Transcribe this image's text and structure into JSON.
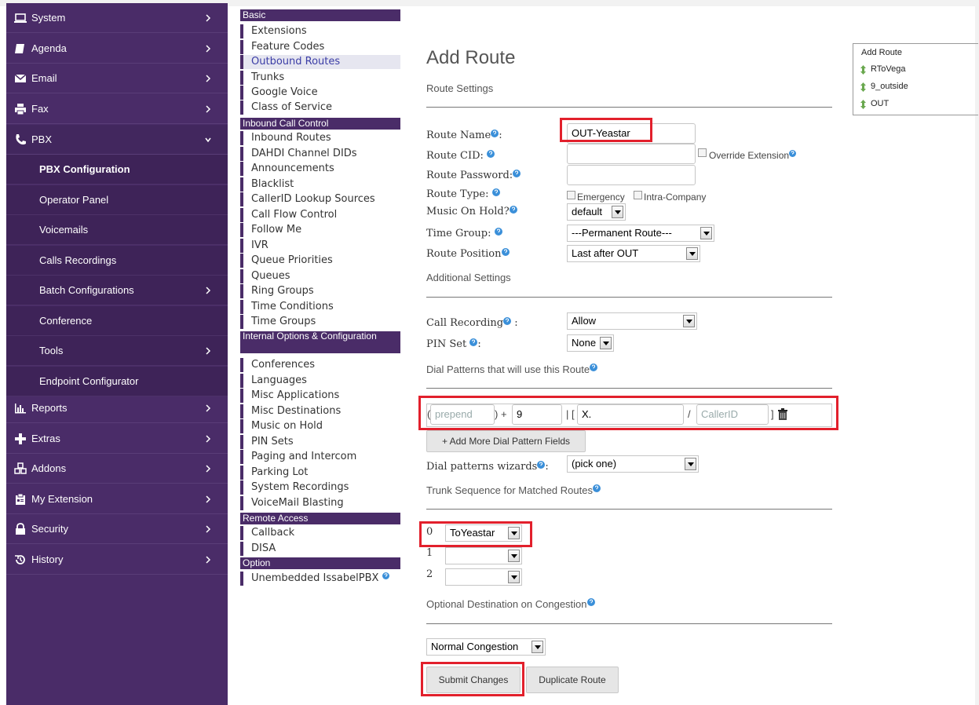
{
  "sidebar": {
    "top_items": [
      {
        "label": "System",
        "icon": "laptop-icon"
      },
      {
        "label": "Agenda",
        "icon": "book-icon"
      },
      {
        "label": "Email",
        "icon": "envelope-icon"
      },
      {
        "label": "Fax",
        "icon": "printer-icon"
      },
      {
        "label": "PBX",
        "icon": "phone-icon"
      }
    ],
    "pbx_sub": [
      {
        "label": "PBX Configuration"
      },
      {
        "label": "Operator Panel"
      },
      {
        "label": "Voicemails"
      },
      {
        "label": "Calls Recordings"
      },
      {
        "label": "Batch Configurations"
      },
      {
        "label": "Conference"
      },
      {
        "label": "Tools"
      },
      {
        "label": "Endpoint Configurator"
      }
    ],
    "bottom_items": [
      {
        "label": "Reports",
        "icon": "bar-chart-icon"
      },
      {
        "label": "Extras",
        "icon": "plus-icon"
      },
      {
        "label": "Addons",
        "icon": "cubes-icon"
      },
      {
        "label": "My Extension",
        "icon": "id-card-icon"
      },
      {
        "label": "Security",
        "icon": "lock-icon"
      },
      {
        "label": "History",
        "icon": "history-icon"
      }
    ]
  },
  "module_menu": {
    "headers": [
      "Basic",
      "Inbound Call Control",
      "Internal Options & Configuration",
      "Remote Access",
      "Option"
    ],
    "basic": [
      "Extensions",
      "Feature Codes",
      "Outbound Routes",
      "Trunks",
      "Google Voice",
      "Class of Service"
    ],
    "inbound": [
      "Inbound Routes",
      "DAHDI Channel DIDs",
      "Announcements",
      "Blacklist",
      "CallerID Lookup Sources",
      "Call Flow Control",
      "Follow Me",
      "IVR",
      "Queue Priorities",
      "Queues",
      "Ring Groups",
      "Time Conditions",
      "Time Groups"
    ],
    "internal": [
      "Conferences",
      "Languages",
      "Misc Applications",
      "Misc Destinations",
      "Music on Hold",
      "PIN Sets",
      "Paging and Intercom",
      "Parking Lot",
      "System Recordings",
      "VoiceMail Blasting"
    ],
    "remote": [
      "Callback",
      "DISA"
    ],
    "option": [
      "Unembedded IssabelPBX"
    ]
  },
  "form": {
    "title": "Add Route",
    "route_settings": "Route Settings",
    "route_name_label": "Route Name",
    "route_name_value": "OUT-Yeastar",
    "route_cid_label": "Route CID:",
    "override_ext_label": "Override Extension",
    "route_password_label": "Route Password:",
    "route_type_label": "Route Type:",
    "emergency_label": "Emergency",
    "intra_company_label": "Intra-Company",
    "music_on_hold_label": "Music On Hold?",
    "music_on_hold_value": "default",
    "time_group_label": "Time Group:",
    "time_group_value": "---Permanent Route---",
    "route_position_label": "Route Position",
    "route_position_value": "Last after OUT",
    "additional_settings": "Additional Settings",
    "call_recording_label": "Call Recording",
    "call_recording_value": "Allow",
    "pin_set_label": "PIN Set",
    "pin_set_value": "None",
    "dial_patterns_heading": "Dial Patterns that will use this Route",
    "prepend_placeholder": "prepend",
    "prefix_value": "9",
    "match_pattern_value": "X.",
    "callerid_placeholder": "CallerID",
    "open_paren": "(",
    "close_paren_plus": ") +",
    "pipe_bracket": "| [",
    "slash": "/",
    "close_bracket": "]",
    "add_more_label": "+ Add More Dial Pattern Fields",
    "dial_wizards_label": "Dial patterns wizards",
    "dial_wizards_value": "(pick one)",
    "trunk_sequence_heading": "Trunk Sequence for Matched Routes",
    "trunks": [
      {
        "index": "0",
        "value": "ToYeastar"
      },
      {
        "index": "1",
        "value": ""
      },
      {
        "index": "2",
        "value": ""
      }
    ],
    "congestion_heading": "Optional Destination on Congestion",
    "congestion_value": "Normal Congestion",
    "submit_label": "Submit Changes",
    "duplicate_label": "Duplicate Route"
  },
  "route_list": {
    "header": "Add Route",
    "routes": [
      "RToVega",
      "9_outside",
      "OUT"
    ]
  },
  "colors": {
    "sidebar_bg": "#4a2c68",
    "highlight_red": "#e2202c",
    "help_blue": "#3a8fd9"
  }
}
